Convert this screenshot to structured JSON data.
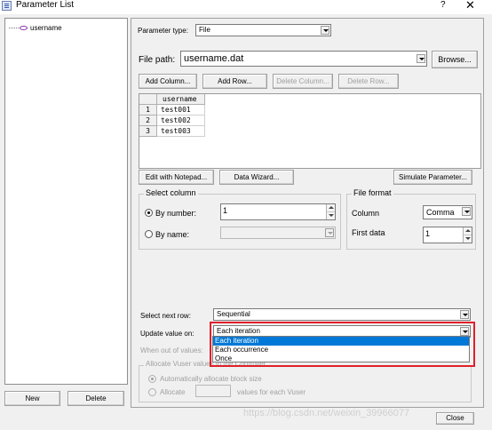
{
  "window": {
    "title": "Parameter List",
    "help": "?",
    "close": "✕"
  },
  "tree": {
    "items": [
      {
        "label": "username"
      }
    ]
  },
  "bottom_buttons": {
    "new": "New",
    "delete": "Delete"
  },
  "param_type": {
    "label": "Parameter type:",
    "value": "File"
  },
  "file_path": {
    "label": "File path:",
    "value": "username.dat",
    "browse": "Browse..."
  },
  "grid_buttons": {
    "add_column": "Add Column...",
    "add_row": "Add Row...",
    "delete_column": "Delete Column...",
    "delete_row": "Delete Row..."
  },
  "grid": {
    "columns": [
      "username"
    ],
    "rows": [
      {
        "num": "1",
        "value": "test001"
      },
      {
        "num": "2",
        "value": "test002"
      },
      {
        "num": "3",
        "value": "test003"
      }
    ]
  },
  "action_buttons": {
    "edit_notepad": "Edit with Notepad...",
    "data_wizard": "Data Wizard...",
    "simulate": "Simulate Parameter..."
  },
  "select_column": {
    "title": "Select column",
    "by_number": "By number:",
    "by_number_value": "1",
    "by_name": "By name:"
  },
  "file_format": {
    "title": "File format",
    "column_label": "Column",
    "column_value": "Comma",
    "first_data_label": "First data",
    "first_data_value": "1"
  },
  "next_row": {
    "label": "Select next row:",
    "value": "Sequential"
  },
  "update_value": {
    "label": "Update value on:",
    "value": "Each iteration",
    "options": [
      "Each iteration",
      "Each occurrence",
      "Once"
    ]
  },
  "out_of_values": {
    "label": "When out of values:"
  },
  "allocate": {
    "title": "Allocate Vuser values in the Controller",
    "auto": "Automatically allocate block size",
    "allocate": "Allocate",
    "suffix": "values for each Vuser"
  },
  "close_button": "Close",
  "watermark": "https://blog.csdn.net/weixin_39966077"
}
